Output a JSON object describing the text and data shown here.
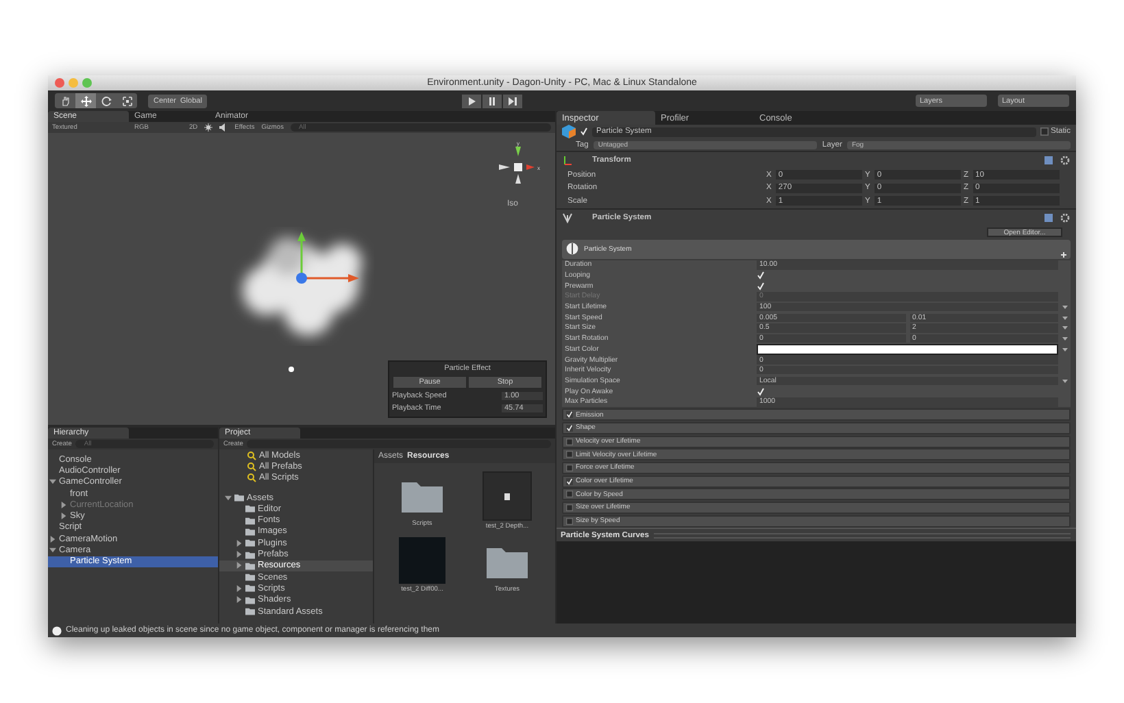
{
  "window": {
    "title": "Environment.unity - Dagon-Unity - PC, Mac & Linux Standalone"
  },
  "toolbar": {
    "tools": [
      {
        "kind": "hand",
        "selected": false
      },
      {
        "kind": "move",
        "selected": true
      },
      {
        "kind": "rotate",
        "selected": false
      },
      {
        "kind": "scale",
        "selected": false
      }
    ],
    "pivot": "Center",
    "space": "Global",
    "layers": "Layers",
    "layout": "Layout"
  },
  "scene": {
    "tabs": [
      {
        "label": "Scene",
        "selected": true
      },
      {
        "label": "Game",
        "selected": false
      },
      {
        "label": "Animator",
        "selected": false
      }
    ],
    "shading": "Textured",
    "render_mode": "RGB",
    "mode_2d": "2D",
    "effects": "Effects",
    "gizmos": "Gizmos",
    "search_placeholder": "All",
    "axis_labels": [
      "y",
      "x"
    ],
    "projection": "Iso",
    "particle_effect": {
      "title": "Particle Effect",
      "buttons": [
        "Pause",
        "Stop"
      ],
      "rows": [
        {
          "label": "Playback Speed",
          "value": "1.00"
        },
        {
          "label": "Playback Time",
          "value": "45.74"
        }
      ]
    }
  },
  "hierarchy": {
    "tab": "Hierarchy",
    "create": "Create",
    "search_placeholder": "All",
    "items": [
      {
        "label": "Console",
        "inactive": false,
        "selected": false
      },
      {
        "label": "AudioController",
        "inactive": false,
        "selected": false
      },
      {
        "label": "GameController",
        "inactive": false,
        "selected": false,
        "expanded": true,
        "children": [
          {
            "label": "front",
            "inactive": false,
            "selected": false
          },
          {
            "label": "CurrentLocation",
            "inactive": true,
            "selected": false,
            "expanded": false
          },
          {
            "label": "Sky",
            "inactive": false,
            "selected": false,
            "expanded": false
          }
        ]
      },
      {
        "label": "Script",
        "inactive": false,
        "selected": false
      },
      {
        "label": "CameraMotion",
        "inactive": false,
        "selected": false,
        "expanded": false
      },
      {
        "label": "Camera",
        "inactive": false,
        "selected": false,
        "expanded": true,
        "children": [
          {
            "label": "Particle System",
            "inactive": false,
            "selected": true
          }
        ]
      }
    ]
  },
  "project": {
    "tab": "Project",
    "create": "Create",
    "favorites": [
      "All Models",
      "All Prefabs",
      "All Scripts"
    ],
    "folders": [
      {
        "label": "Assets",
        "selected": false,
        "expanded": true,
        "children": [
          {
            "label": "Editor",
            "selected": false
          },
          {
            "label": "Fonts",
            "selected": false
          },
          {
            "label": "Images",
            "selected": false
          },
          {
            "label": "Plugins",
            "selected": false,
            "expanded": false
          },
          {
            "label": "Prefabs",
            "selected": false,
            "expanded": false
          },
          {
            "label": "Resources",
            "selected": true,
            "expanded": false
          },
          {
            "label": "Scenes",
            "selected": false
          },
          {
            "label": "Scripts",
            "selected": false,
            "expanded": false
          },
          {
            "label": "Shaders",
            "selected": false,
            "expanded": false
          },
          {
            "label": "Standard Assets",
            "selected": false
          }
        ]
      }
    ],
    "breadcrumb": [
      "Assets",
      "Resources"
    ],
    "assets": [
      {
        "name": "Scripts",
        "kind": "folder"
      },
      {
        "name": "test_2 Depth...",
        "kind": "texture"
      },
      {
        "name": "test_2 Diff00...",
        "kind": "image"
      },
      {
        "name": "Textures",
        "kind": "folder"
      }
    ]
  },
  "inspector": {
    "tabs": [
      {
        "label": "Inspector",
        "selected": true
      },
      {
        "label": "Profiler",
        "selected": false
      },
      {
        "label": "Console",
        "selected": false
      }
    ],
    "object": {
      "active": true,
      "name": "Particle System",
      "static_label": "Static",
      "static": false,
      "tag_label": "Tag",
      "tag": "Untagged",
      "layer_label": "Layer",
      "layer": "Fog"
    },
    "transform": {
      "title": "Transform",
      "rows": [
        {
          "label": "Position",
          "fields": [
            {
              "axis": "X",
              "value": "0"
            },
            {
              "axis": "Y",
              "value": "0"
            },
            {
              "axis": "Z",
              "value": "10"
            }
          ]
        },
        {
          "label": "Rotation",
          "fields": [
            {
              "axis": "X",
              "value": "270"
            },
            {
              "axis": "Y",
              "value": "0"
            },
            {
              "axis": "Z",
              "value": "0"
            }
          ]
        },
        {
          "label": "Scale",
          "fields": [
            {
              "axis": "X",
              "value": "1"
            },
            {
              "axis": "Y",
              "value": "1"
            },
            {
              "axis": "Z",
              "value": "1"
            }
          ]
        }
      ]
    },
    "particle_system": {
      "title": "Particle System",
      "open_editor": "Open Editor...",
      "module_title": "Particle System",
      "properties": [
        {
          "label": "Duration",
          "kind": "text",
          "value": "10.00",
          "disabled": false
        },
        {
          "label": "Looping",
          "kind": "check",
          "checked": true,
          "disabled": false
        },
        {
          "label": "Prewarm",
          "kind": "check",
          "checked": true,
          "disabled": false
        },
        {
          "label": "Start Delay",
          "kind": "text",
          "value": "0",
          "disabled": true
        },
        {
          "label": "Start Lifetime",
          "kind": "curve",
          "value": "100",
          "disabled": false
        },
        {
          "label": "Start Speed",
          "kind": "range",
          "value": "0.005",
          "value_2": "0.01",
          "disabled": false
        },
        {
          "label": "Start Size",
          "kind": "range",
          "value": "0.5",
          "value_2": "2",
          "disabled": false
        },
        {
          "label": "Start Rotation",
          "kind": "range",
          "value": "0",
          "value_2": "0",
          "disabled": false
        },
        {
          "label": "Start Color",
          "kind": "color",
          "color": "#ffffff",
          "disabled": false
        },
        {
          "label": "Gravity Multiplier",
          "kind": "text",
          "value": "0",
          "disabled": false
        },
        {
          "label": "Inherit Velocity",
          "kind": "text",
          "value": "0",
          "disabled": false
        },
        {
          "label": "Simulation Space",
          "kind": "dropdown",
          "value": "Local",
          "disabled": false
        },
        {
          "label": "Play On Awake",
          "kind": "check",
          "checked": true,
          "disabled": false
        },
        {
          "label": "Max Particles",
          "kind": "text",
          "value": "1000",
          "disabled": false
        }
      ],
      "modules": [
        {
          "label": "Emission",
          "enabled": true
        },
        {
          "label": "Shape",
          "enabled": true
        },
        {
          "label": "Velocity over Lifetime",
          "enabled": false
        },
        {
          "label": "Limit Velocity over Lifetime",
          "enabled": false
        },
        {
          "label": "Force over Lifetime",
          "enabled": false
        },
        {
          "label": "Color over Lifetime",
          "enabled": true
        },
        {
          "label": "Color by Speed",
          "enabled": false
        },
        {
          "label": "Size over Lifetime",
          "enabled": false
        },
        {
          "label": "Size by Speed",
          "enabled": false
        }
      ]
    },
    "curves_title": "Particle System Curves"
  },
  "status_bar": {
    "message": "Cleaning up leaked objects in scene since no game object, component or manager is referencing them"
  }
}
